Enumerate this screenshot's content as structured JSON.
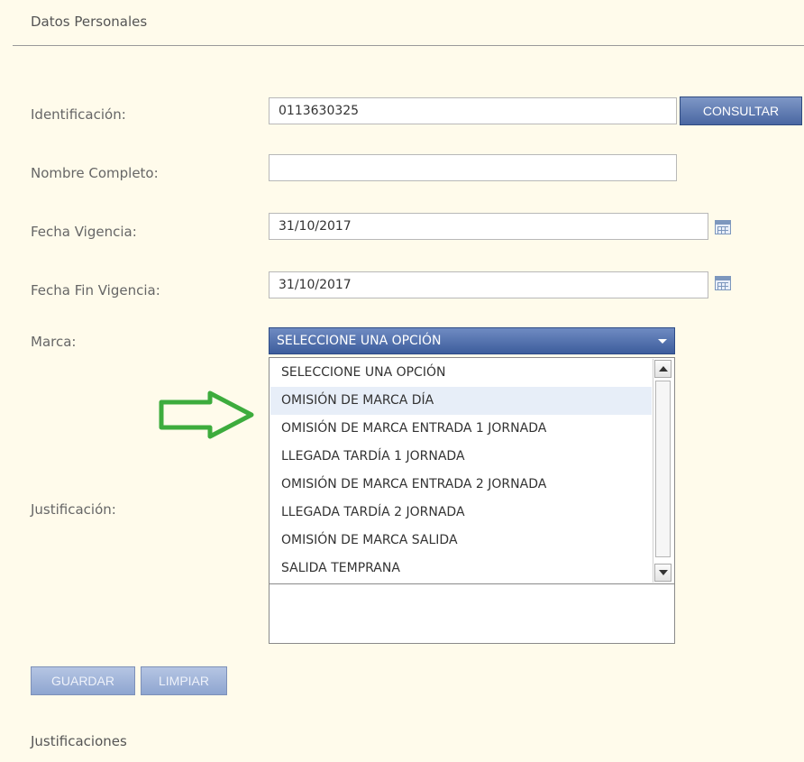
{
  "section_title": "Datos Personales",
  "form": {
    "identificacion": {
      "label": "Identificación:",
      "value": "0113630325",
      "button": "CONSULTAR"
    },
    "nombre": {
      "label": "Nombre Completo:",
      "value": ""
    },
    "fecha_vigencia": {
      "label": "Fecha Vigencia:",
      "value": "31/10/2017"
    },
    "fecha_fin": {
      "label": "Fecha Fin Vigencia:",
      "value": "31/10/2017"
    },
    "marca": {
      "label": "Marca:",
      "selected": "SELECCIONE UNA OPCIÓN",
      "options": [
        "SELECCIONE UNA OPCIÓN",
        "OMISIÓN DE MARCA DÍA",
        "OMISIÓN DE MARCA ENTRADA 1 JORNADA",
        "LLEGADA TARDÍA 1 JORNADA",
        "OMISIÓN DE MARCA ENTRADA 2 JORNADA",
        "LLEGADA TARDÍA 2 JORNADA",
        "OMISIÓN DE MARCA SALIDA",
        "SALIDA TEMPRANA"
      ],
      "highlighted_index": 1
    },
    "justificacion": {
      "label": "Justificación:",
      "value": ""
    }
  },
  "buttons": {
    "guardar": "GUARDAR",
    "limpiar": "LIMPIAR"
  },
  "footer_title": "Justificaciones",
  "colors": {
    "background": "#fffbeb",
    "primary_button": "#4a67a2",
    "disabled_button": "#9fb2d9",
    "annotation_arrow": "#3dac3d"
  },
  "icons": {
    "calendar": "calendar-icon",
    "annotation": "green-arrow-icon"
  }
}
